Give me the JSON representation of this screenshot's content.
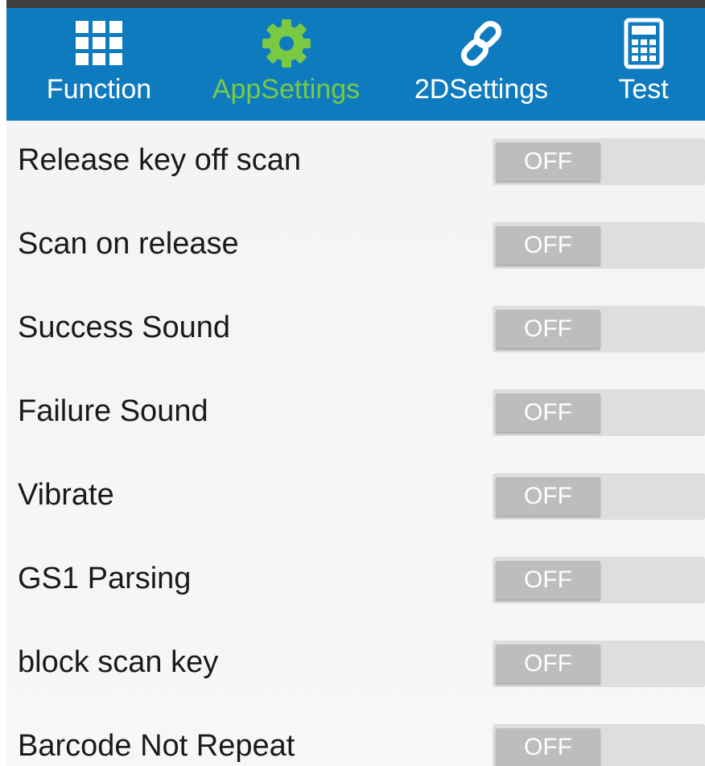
{
  "tabs": [
    {
      "label": "Function",
      "icon": "grid-icon",
      "active": false
    },
    {
      "label": "AppSettings",
      "icon": "gear-icon",
      "active": true
    },
    {
      "label": "2DSettings",
      "icon": "link-icon",
      "active": false
    },
    {
      "label": "Test",
      "icon": "calculator-icon",
      "active": false
    }
  ],
  "settings": [
    {
      "label": "Release key off scan",
      "state": "OFF"
    },
    {
      "label": "Scan on release",
      "state": "OFF"
    },
    {
      "label": "Success Sound",
      "state": "OFF"
    },
    {
      "label": "Failure Sound",
      "state": "OFF"
    },
    {
      "label": "Vibrate",
      "state": "OFF"
    },
    {
      "label": "GS1 Parsing",
      "state": "OFF"
    },
    {
      "label": "block scan key",
      "state": "OFF"
    },
    {
      "label": "Barcode Not Repeat",
      "state": "OFF"
    }
  ],
  "colors": {
    "tabbar_bg": "#0f7bbf",
    "active_tab": "#7ac943",
    "inactive_tab": "#ffffff",
    "toggle_track": "#dedede",
    "toggle_knob": "#bdbdbd"
  }
}
